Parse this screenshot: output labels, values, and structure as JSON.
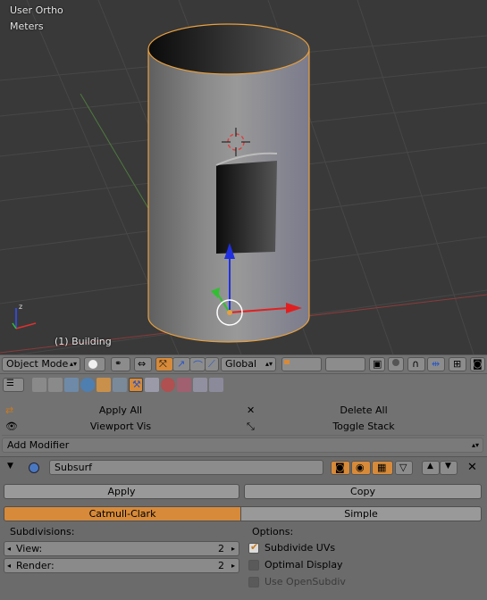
{
  "viewport": {
    "view_name": "User Ortho",
    "units": "Meters",
    "object_label": "(1) Building"
  },
  "header": {
    "mode": "Object Mode",
    "orientation": "Global"
  },
  "modifier_panel": {
    "apply_all": "Apply All",
    "delete_all": "Delete All",
    "viewport_vis": "Viewport Vis",
    "toggle_stack": "Toggle Stack",
    "add_modifier": "Add Modifier",
    "modifier_name": "Subsurf",
    "apply": "Apply",
    "copy": "Copy",
    "type_catmull": "Catmull-Clark",
    "type_simple": "Simple",
    "subdivisions_label": "Subdivisions:",
    "view_label": "View:",
    "view_value": "2",
    "render_label": "Render:",
    "render_value": "2",
    "options_label": "Options:",
    "subdivide_uvs": "Subdivide UVs",
    "optimal_display": "Optimal Display",
    "use_opensubdiv": "Use OpenSubdiv"
  },
  "colors": {
    "accent": "#d68a3a",
    "viewport_bg": "#393939",
    "panel_bg": "#727272"
  }
}
